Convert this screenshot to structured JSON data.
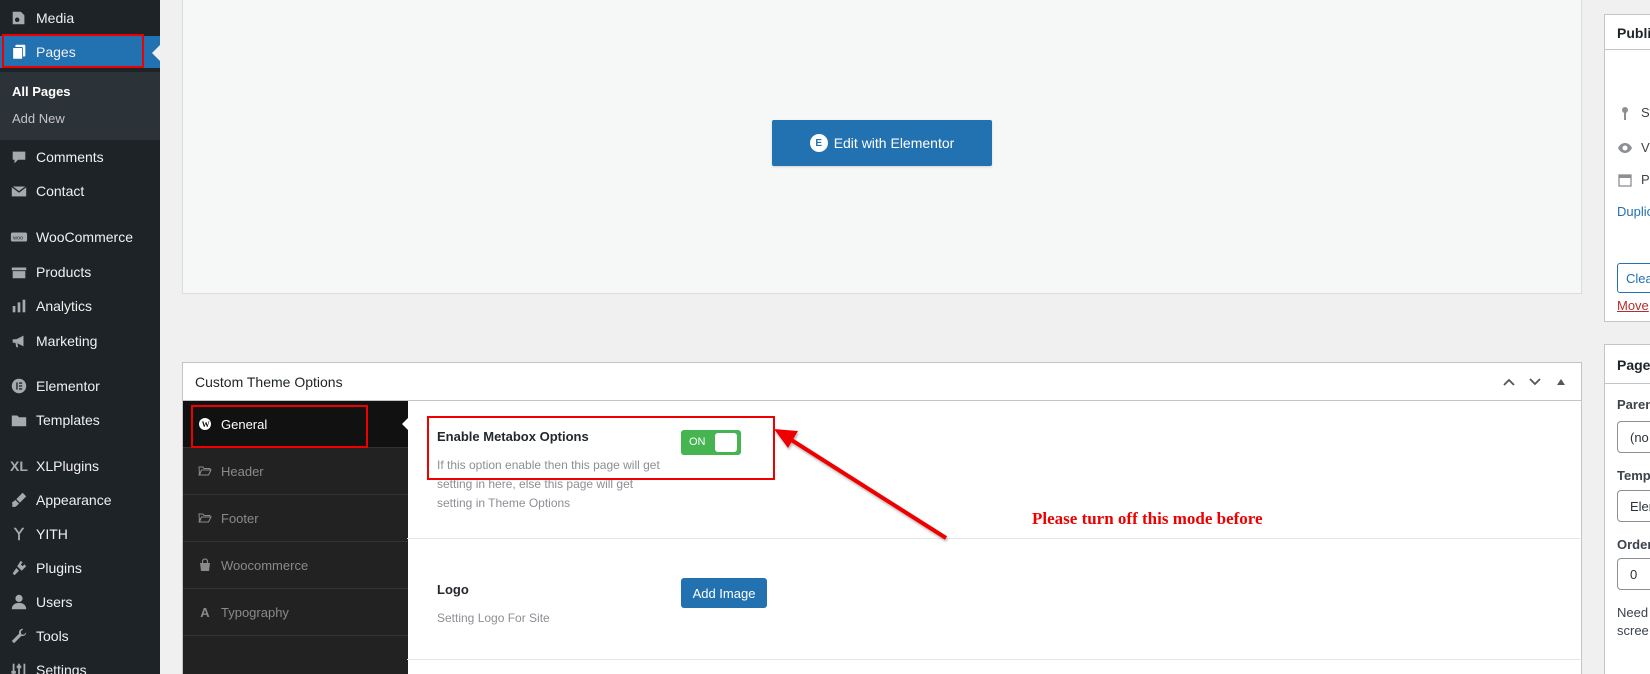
{
  "sidebar": {
    "items": [
      {
        "label": "Media",
        "icon": "media-icon"
      },
      {
        "label": "Pages",
        "icon": "pages-icon",
        "current": true
      },
      {
        "label": "Comments",
        "icon": "comments-icon"
      },
      {
        "label": "Contact",
        "icon": "envelope-icon"
      },
      {
        "label": "WooCommerce",
        "icon": "woocommerce-icon"
      },
      {
        "label": "Products",
        "icon": "products-icon"
      },
      {
        "label": "Analytics",
        "icon": "bar-chart-icon"
      },
      {
        "label": "Marketing",
        "icon": "megaphone-icon"
      },
      {
        "label": "Elementor",
        "icon": "elementor-icon"
      },
      {
        "label": "Templates",
        "icon": "folder-icon"
      },
      {
        "label": "XLPlugins",
        "icon": "xl-icon"
      },
      {
        "label": "Appearance",
        "icon": "brush-icon"
      },
      {
        "label": "YITH",
        "icon": "yith-icon"
      },
      {
        "label": "Plugins",
        "icon": "plugin-icon"
      },
      {
        "label": "Users",
        "icon": "user-icon"
      },
      {
        "label": "Tools",
        "icon": "wrench-icon"
      },
      {
        "label": "Settings",
        "icon": "settings-icon"
      }
    ],
    "submenu": [
      "All Pages",
      "Add New"
    ]
  },
  "editor": {
    "edit_button_label": "Edit with Elementor"
  },
  "metabox": {
    "title": "Custom Theme Options",
    "nav": [
      "General",
      "Header",
      "Footer",
      "Woocommerce",
      "Typography"
    ],
    "options": {
      "enable_metabox_label": "Enable Metabox Options",
      "enable_metabox_desc": "If this option enable then this page will get setting in here, else this page will get setting in Theme Options",
      "toggle_state": "ON",
      "logo_label": "Logo",
      "logo_desc": "Setting Logo For Site",
      "add_image_label": "Add Image"
    }
  },
  "annotation": {
    "text": "Please turn off this mode before"
  },
  "right_sidebar": {
    "publish_title": "Publis",
    "status_text": "St",
    "visibility_text": "Vi",
    "published_text": "Pu",
    "duplicate_link": "Duplic",
    "clear_button": "Clea",
    "move_link": "Move",
    "page_attr_title": "Page",
    "parent_label": "Paren",
    "parent_value": "(no",
    "template_label": "Temp",
    "template_value": "Elen",
    "order_label": "Order",
    "order_value": "0",
    "need_text": "Need",
    "screen_text": "scree"
  },
  "colors": {
    "admin_bg": "#1d2327",
    "accent": "#2271b1",
    "toggle_on": "#46b450",
    "annotation": "#e00000"
  }
}
